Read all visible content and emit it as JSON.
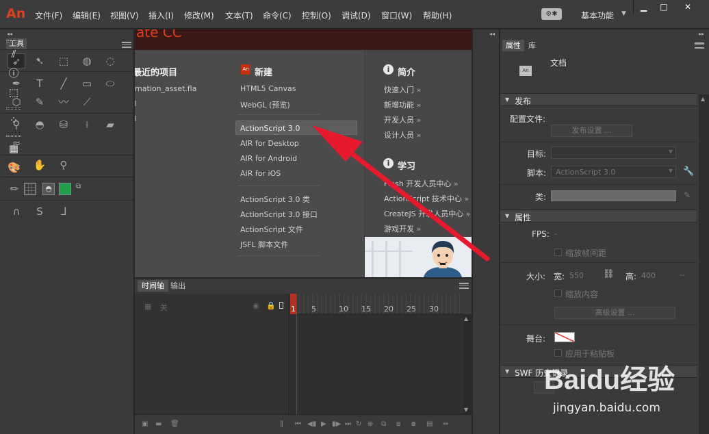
{
  "app": {
    "logo": "An"
  },
  "menu": [
    "文件(F)",
    "编辑(E)",
    "视图(V)",
    "插入(I)",
    "修改(M)",
    "文本(T)",
    "命令(C)",
    "控制(O)",
    "调试(D)",
    "窗口(W)",
    "帮助(H)"
  ],
  "workspace": {
    "label": "基本功能"
  },
  "window_controls": {
    "minimize": "▁",
    "maximize": "□",
    "close": "✕"
  },
  "tools": {
    "tab": "工具"
  },
  "welcome": {
    "header_fragment": "ate CC",
    "recent": {
      "title": "最近的项目",
      "items": [
        "mation_asset.fla"
      ]
    },
    "create": {
      "title": "新建",
      "icon_text": "An",
      "items_a": [
        "HTML5 Canvas",
        "WebGL (预览)"
      ],
      "items_b": [
        "ActionScript 3.0",
        "AIR for Desktop",
        "AIR for Android",
        "AIR for iOS"
      ],
      "items_c": [
        "ActionScript 3.0 类",
        "ActionScript 3.0 接口",
        "ActionScript 文件",
        "JSFL 脚本文件"
      ]
    },
    "intro": {
      "title": "简介",
      "items": [
        "快速入门",
        "新增功能",
        "开发人员",
        "设计人员"
      ]
    },
    "learn": {
      "title": "学习",
      "items": [
        "Flash 开发人员中心",
        "ActionScript 技术中心",
        "CreateJS 开发人员中心",
        "游戏开发"
      ]
    },
    "link_arrow": "»"
  },
  "timeline": {
    "tabs": [
      "时间轴",
      "输出"
    ],
    "layer_off": "关",
    "frames": [
      "1",
      "5",
      "10",
      "15",
      "20",
      "25",
      "30"
    ]
  },
  "properties": {
    "tabs": [
      "属性",
      "库"
    ],
    "doc_title": "文档",
    "doc_icon": "An",
    "publish": {
      "header": "发布",
      "profile_label": "配置文件:",
      "settings_button": "发布设置 ...",
      "target_label": "目标:",
      "script_label": "脚本:",
      "script_value": "ActionScript 3.0",
      "class_label": "类:"
    },
    "props_section": {
      "header": "属性",
      "fps_label": "FPS:",
      "fps_value": "-",
      "scale_interval": "缩放帧间距",
      "size_label": "大小:",
      "width_label": "宽:",
      "width_value": "550",
      "height_label": "高:",
      "height_value": "400",
      "units": "--",
      "scale_content": "缩放内容",
      "advanced_button": "高级设置 ...",
      "stage_label": "舞台:",
      "apply_pasteboard": "应用于粘贴板"
    },
    "swf": {
      "header": "SWF 历史记录"
    }
  },
  "watermark": {
    "main": "Baidu经验",
    "sub": "jingyan.baidu.com"
  },
  "colors": {
    "accent": "#d9421b",
    "arrow": "#e8192c",
    "stage_swatch": "#1e9e4a"
  }
}
